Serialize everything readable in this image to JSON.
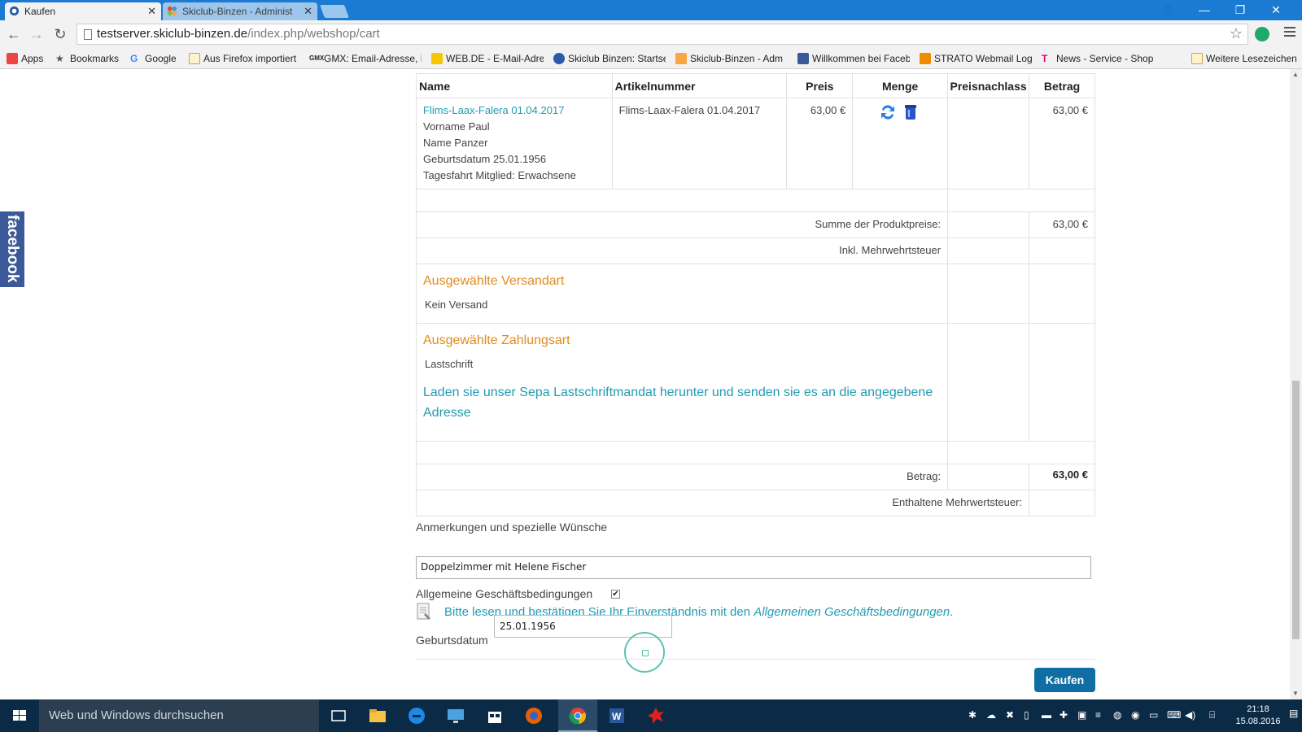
{
  "browser": {
    "tabs": [
      {
        "title": "Kaufen",
        "active": true
      },
      {
        "title": "Skiclub-Binzen - Administ",
        "active": false
      }
    ],
    "url_host": "testserver.skiclub-binzen.de",
    "url_path": "/index.php/webshop/cart",
    "bookmarks": [
      "Apps",
      "Bookmarks",
      "Google",
      "Aus Firefox importiert",
      "GMX: Email-Adresse, F",
      "WEB.DE - E-Mail-Adre",
      "Skiclub Binzen: Startse",
      "Skiclub-Binzen - Adm",
      "Willkommen bei Faceb",
      "STRATO Webmail Log",
      "News - Service - Shop",
      "Weitere Lesezeichen"
    ]
  },
  "page": {
    "facebook_tab": "facebook",
    "cart": {
      "headers": {
        "name": "Name",
        "article": "Artikelnummer",
        "price": "Preis",
        "quantity": "Menge",
        "discount": "Preisnachlass",
        "amount": "Betrag"
      },
      "item": {
        "name": "Flims-Laax-Falera 01.04.2017",
        "details": [
          "Vorname Paul",
          "Name Panzer",
          "Geburtsdatum 25.01.1956",
          "Tagesfahrt Mitglied: Erwachsene"
        ],
        "article_no": "Flims-Laax-Falera 01.04.2017",
        "price": "63,00 €",
        "amount": "63,00 €"
      },
      "sum_label": "Summe der Produktpreise:",
      "sum_value": "63,00 €",
      "vat_label": "Inkl. Mehrwehrtsteuer",
      "shipping_heading": "Ausgewählte Versandart",
      "shipping_value": "Kein Versand",
      "payment_heading": "Ausgewählte Zahlungsart",
      "payment_value": "Lastschrift",
      "sepa_link": "Laden sie unser Sepa Lastschriftmandat herunter und senden sie es an die angegebene Adresse",
      "total_label": "Betrag:",
      "total_value": "63,00 €",
      "included_vat_label": "Enthaltene Mehrwertsteuer:"
    },
    "remarks_label": "Anmerkungen und spezielle Wünsche",
    "remarks_value": "Doppelzimmer mit Helene Fischer",
    "agb_label": "Allgemeine Geschäftsbedingungen",
    "agb_checked": "✔",
    "agb_text_prefix": "Bitte lesen und bestätigen Sie Ihr Einverständnis mit den",
    "agb_text_link": "Allgemeinen Geschäftsbedingungen",
    "agb_text_suffix": ".",
    "birth_label": "Geburtsdatum",
    "birth_value": "25.01.1956",
    "buy_button": "Kaufen"
  },
  "taskbar": {
    "search_placeholder": "Web und Windows durchsuchen",
    "time": "21:18",
    "date": "15.08.2016"
  },
  "colors": {
    "chrome_blue": "#1b7bd3",
    "link_teal": "#1f9cb2",
    "heading_orange": "#e08b1f",
    "button_blue": "#0f6ea3",
    "taskbar": "#0b2a46"
  }
}
